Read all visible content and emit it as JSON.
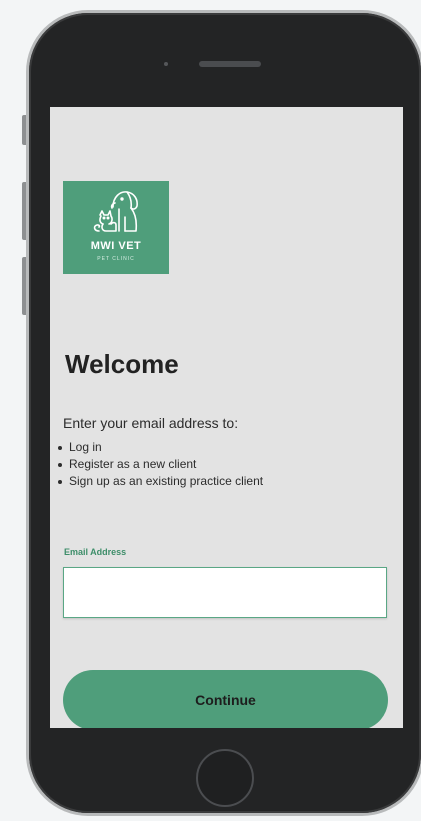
{
  "logo": {
    "icon": "dog-and-cat-icon",
    "title": "MWI VET",
    "subtitle": "PET CLINIC",
    "color": "#4f9e7b"
  },
  "main": {
    "heading": "Welcome",
    "intro": "Enter your email address to:",
    "options": [
      "Log in",
      "Register as a new client",
      "Sign up as an existing practice client"
    ]
  },
  "form": {
    "email_label": "Email Address",
    "email_value": "",
    "email_placeholder": "",
    "continue_label": "Continue"
  },
  "colors": {
    "accent": "#4f9e7b",
    "screen_bg": "#e3e3e3",
    "phone_body": "#232425"
  }
}
